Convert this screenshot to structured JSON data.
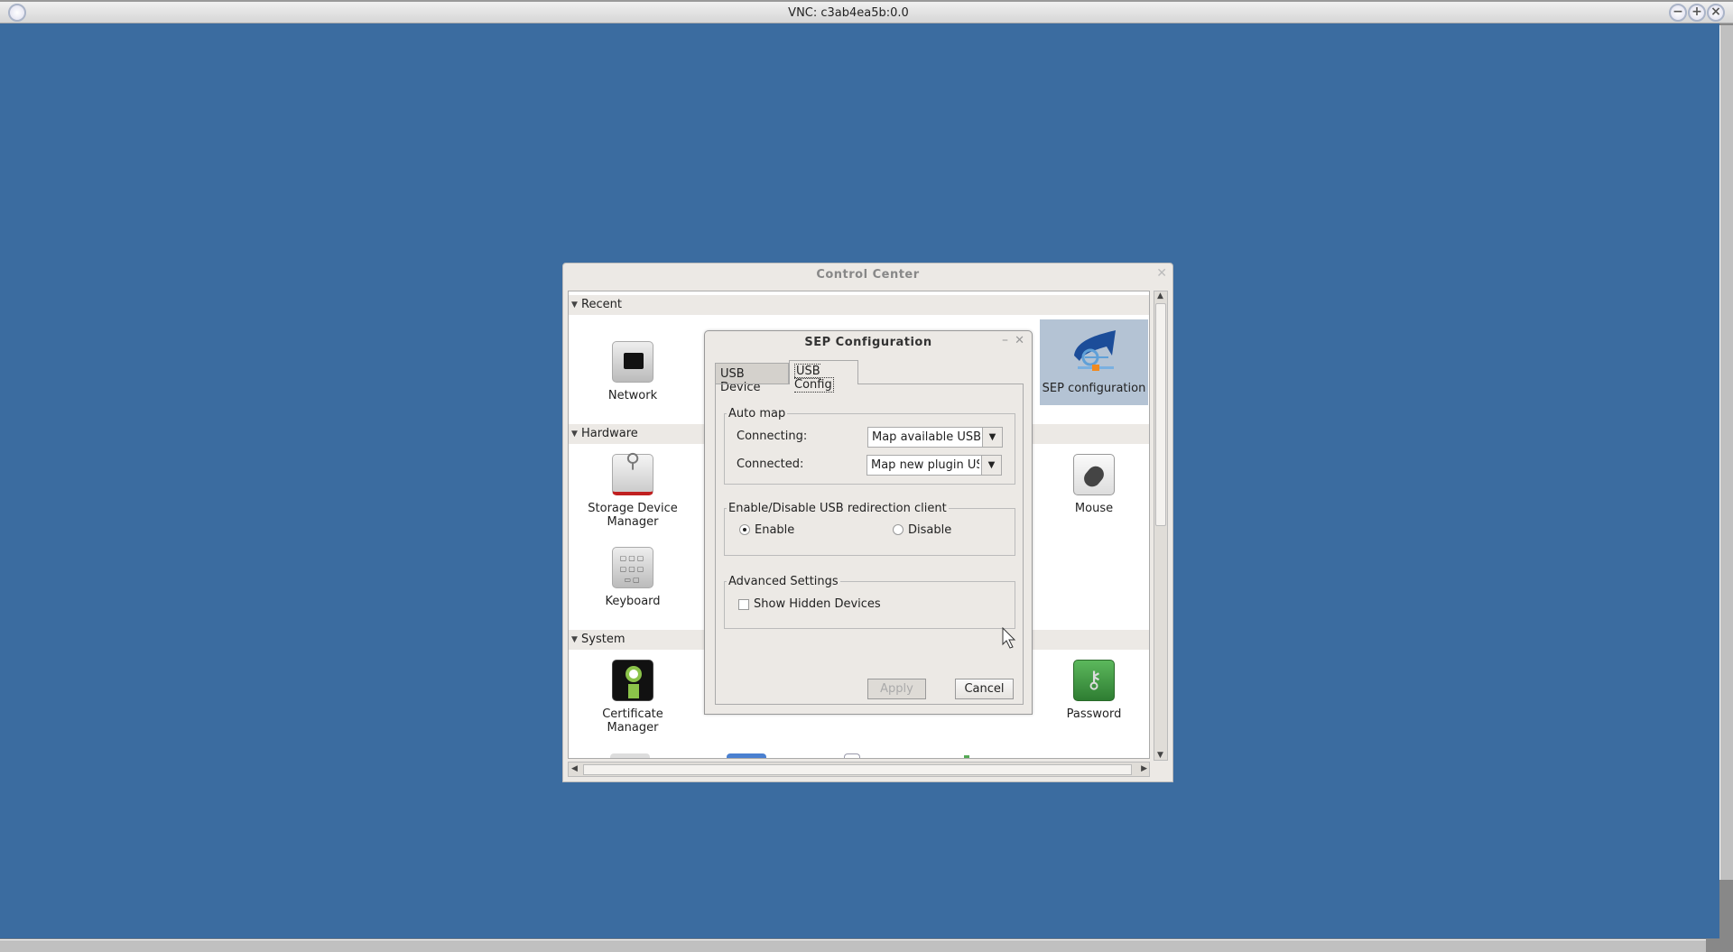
{
  "vnc": {
    "title": "VNC: c3ab4ea5b:0.0",
    "buttons": [
      "minimize",
      "maximize",
      "close"
    ]
  },
  "control_center": {
    "title": "Control Center",
    "sections": [
      {
        "name": "Recent",
        "items": [
          {
            "label": "Network",
            "icon": "network-icon"
          },
          {
            "label": "SEP configuration",
            "icon": "sep-configuration-icon",
            "selected": true
          }
        ]
      },
      {
        "name": "Hardware",
        "items": [
          {
            "label": "Storage Device Manager",
            "icon": "storage-device-icon"
          },
          {
            "label": "Mouse",
            "icon": "mouse-icon"
          },
          {
            "label": "Keyboard",
            "icon": "keyboard-icon"
          }
        ]
      },
      {
        "name": "System",
        "items": [
          {
            "label": "Certificate Manager",
            "icon": "certificate-icon"
          },
          {
            "label": "Password",
            "icon": "password-icon"
          }
        ]
      }
    ],
    "labels": {
      "network": "Network",
      "sep": "SEP configuration",
      "storage1": "Storage Device",
      "storage2": "Manager",
      "mouse": "Mouse",
      "keyboard": "Keyboard",
      "cert1": "Certificate",
      "cert2": "Manager",
      "password": "Password"
    }
  },
  "dialog": {
    "title": "SEP Configuration",
    "tabs": [
      {
        "label": "USB Device",
        "active": false
      },
      {
        "label": "USB Config",
        "active": true
      }
    ],
    "auto_map": {
      "legend": "Auto map",
      "connecting_label": "Connecting:",
      "connecting_value": "Map available USB devices",
      "connected_label": "Connected:",
      "connected_value": "Map new plugin USB devices"
    },
    "redirection": {
      "legend": "Enable/Disable USB redirection client",
      "enable": "Enable",
      "disable": "Disable",
      "selected": "Enable"
    },
    "advanced": {
      "legend": "Advanced Settings",
      "show_hidden": "Show Hidden Devices",
      "show_hidden_checked": false
    },
    "apply": "Apply",
    "cancel": "Cancel"
  }
}
